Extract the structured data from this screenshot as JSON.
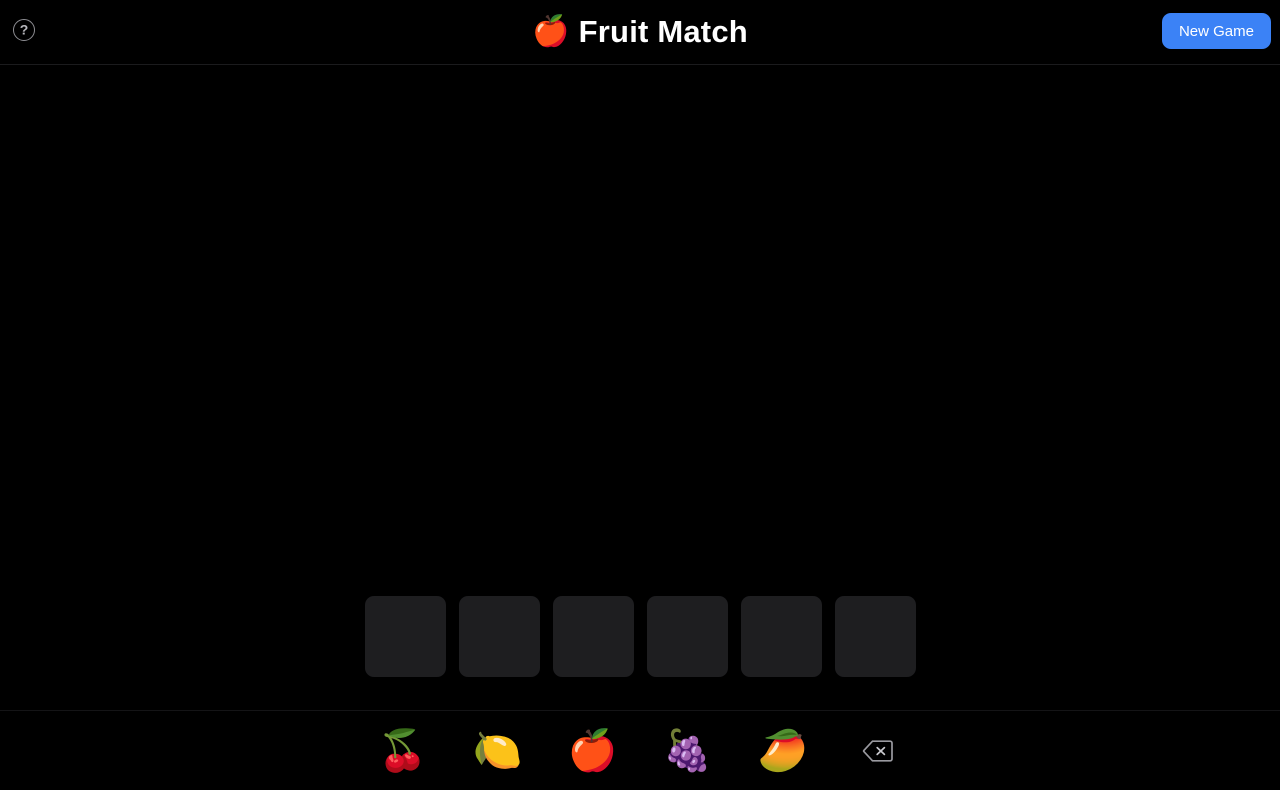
{
  "header": {
    "help_icon": "question-circle-icon",
    "help_glyph": "?",
    "title_emoji": "🍎",
    "title": "Fruit Match",
    "new_game_label": "New Game",
    "accent_color": "#3b82f6"
  },
  "board": {
    "tile_color": "#1e1e20",
    "rows": [
      {
        "tiles": [
          "",
          "",
          "",
          "",
          "",
          ""
        ]
      }
    ]
  },
  "keyboard": {
    "keys": [
      {
        "name": "cherries",
        "glyph": "🍒"
      },
      {
        "name": "lemon",
        "glyph": "🍋"
      },
      {
        "name": "apple",
        "glyph": "🍎"
      },
      {
        "name": "grapes",
        "glyph": "🍇"
      },
      {
        "name": "mango",
        "glyph": "🥭"
      }
    ],
    "backspace_icon": "backspace-icon"
  }
}
